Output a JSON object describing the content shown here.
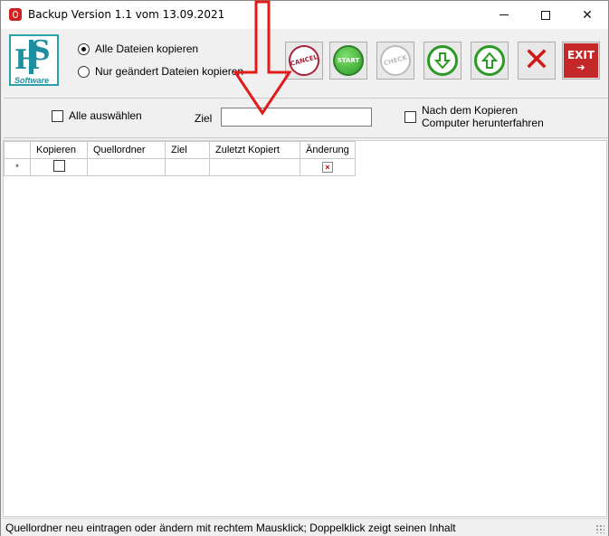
{
  "window": {
    "title": "Backup Version 1.1 vom 13.09.2021",
    "controls": {
      "minimize": "—",
      "maximize": "☐",
      "close": "✕"
    }
  },
  "logo": {
    "letters_h": "H",
    "letters_s": "S",
    "subtitle": "Software",
    "color": "#1d8fa0"
  },
  "options": {
    "radio_all": "Alle Dateien kopieren",
    "radio_changed": "Nur geändert Dateien kopieren",
    "selected": "all"
  },
  "toolbar": {
    "cancel_stamp": "CANCEL",
    "start_stamp": "START",
    "check_stamp": "CHECK",
    "exit_label": "EXIT"
  },
  "filter": {
    "select_all_label": "Alle auswählen",
    "ziel_label": "Ziel",
    "ziel_value": "",
    "shutdown_line1": "Nach dem Kopieren",
    "shutdown_line2": "Computer herunterfahren"
  },
  "grid": {
    "columns": [
      "Kopieren",
      "Quellordner",
      "Ziel",
      "Zuletzt Kopiert",
      "Änderung"
    ],
    "new_row_marker": "*"
  },
  "status": {
    "text": "Quellordner neu eintragen oder ändern mit rechtem Mausklick; Doppelklick zeigt seinen Inhalt"
  },
  "colors": {
    "annotation_arrow": "#e11a1a",
    "exit_bg": "#c52828",
    "accent_green": "#2a9a22"
  }
}
